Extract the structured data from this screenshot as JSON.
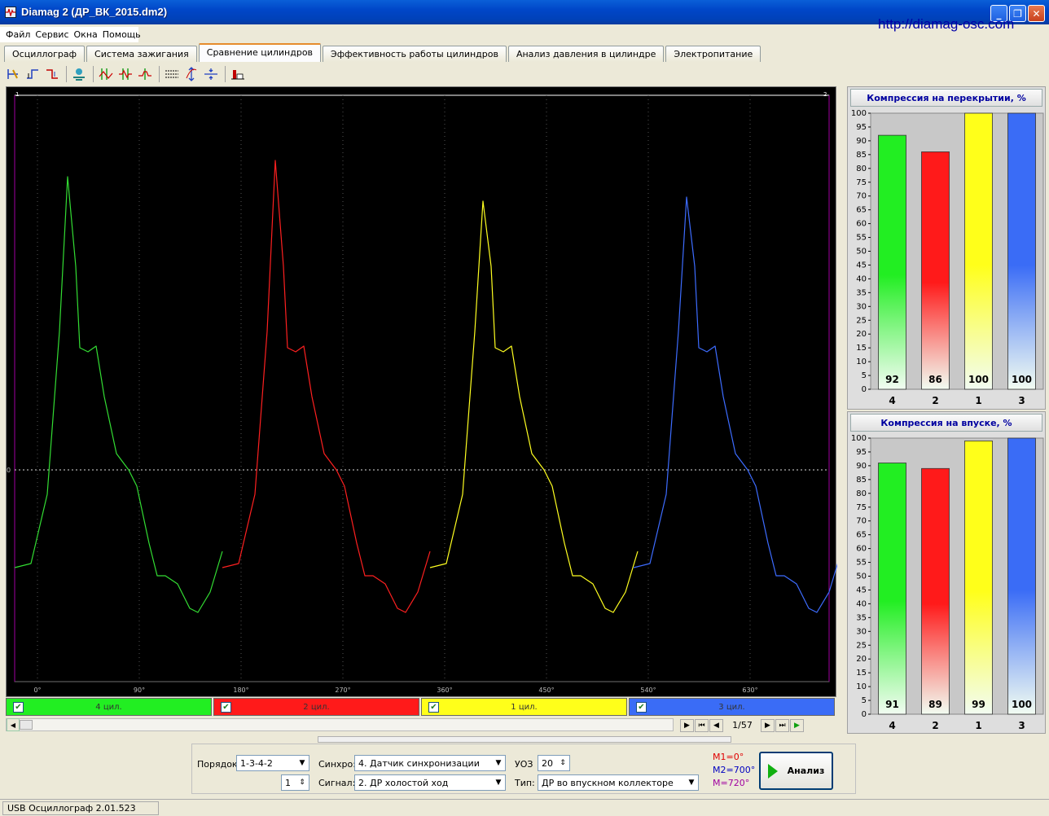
{
  "window": {
    "title": "Diamag 2 (ДР_ВК_2015.dm2)",
    "website": "http://diamag-osc.com"
  },
  "menu": [
    "Файл",
    "Сервис",
    "Окна",
    "Помощь"
  ],
  "tabs": [
    {
      "label": "Осциллограф",
      "active": false
    },
    {
      "label": "Система зажигания",
      "active": false
    },
    {
      "label": "Сравнение цилиндров",
      "active": true
    },
    {
      "label": "Эффективность работы цилиндров",
      "active": false
    },
    {
      "label": "Анализ давления в цилиндре",
      "active": false
    },
    {
      "label": "Электропитание",
      "active": false
    }
  ],
  "toolbar_icons": [
    "cursor-tool-icon",
    "rising-edge-icon",
    "falling-edge-icon",
    "sync-icon",
    "marker-1-icon",
    "marker-2-icon",
    "marker-3-icon",
    "grid-lines-icon",
    "scale-vertical-icon",
    "level-line-icon",
    "bars-chart-icon"
  ],
  "scope": {
    "corner_left": "1",
    "corner_right": "2",
    "zero_label": "0",
    "x_ticks": [
      "0°",
      "90°",
      "180°",
      "270°",
      "360°",
      "450°",
      "540°",
      "630°"
    ],
    "traces": [
      {
        "cylinder": "4",
        "color": "#33dd33"
      },
      {
        "cylinder": "2",
        "color": "#ff2020"
      },
      {
        "cylinder": "1",
        "color": "#ffff20"
      },
      {
        "cylinder": "3",
        "color": "#3d6cff"
      }
    ]
  },
  "cylinders": [
    {
      "label": "4 цил.",
      "color": "#22ee22",
      "checked": true
    },
    {
      "label": "2 цил.",
      "color": "#ff1a1a",
      "checked": true
    },
    {
      "label": "1 цил.",
      "color": "#ffff1a",
      "checked": true
    },
    {
      "label": "3 цил.",
      "color": "#3a6cf6",
      "checked": true
    }
  ],
  "navigation": {
    "page": "1/57"
  },
  "chart_data": [
    {
      "type": "bar",
      "title": "Компрессия на перекрытии, %",
      "categories": [
        "4",
        "2",
        "1",
        "3"
      ],
      "values": [
        92,
        86,
        100,
        100
      ],
      "colors": [
        "#22ee22",
        "#ff1a1a",
        "#ffff1a",
        "#3a6cf6"
      ],
      "ylim": [
        0,
        100
      ],
      "yticks": [
        0,
        5,
        10,
        15,
        20,
        25,
        30,
        35,
        40,
        45,
        50,
        55,
        60,
        65,
        70,
        75,
        80,
        85,
        90,
        95,
        100
      ]
    },
    {
      "type": "bar",
      "title": "Компрессия на впуске, %",
      "categories": [
        "4",
        "2",
        "1",
        "3"
      ],
      "values": [
        91,
        89,
        99,
        100
      ],
      "colors": [
        "#22ee22",
        "#ff1a1a",
        "#ffff1a",
        "#3a6cf6"
      ],
      "ylim": [
        0,
        100
      ],
      "yticks": [
        0,
        5,
        10,
        15,
        20,
        25,
        30,
        35,
        40,
        45,
        50,
        55,
        60,
        65,
        70,
        75,
        80,
        85,
        90,
        95,
        100
      ]
    }
  ],
  "settings": {
    "order_label": "Порядок",
    "order_value": "1-3-4-2",
    "order_num": "1",
    "sync_label": "Синхро:",
    "sync_value": "4. Датчик синхронизации",
    "signal_label": "Сигнал:",
    "signal_value": "2. ДР холостой ход",
    "uoz_label": "УОЗ",
    "uoz_value": "20",
    "type_label": "Тип:",
    "type_value": "ДР во впускном коллекторе",
    "m1": "M1=0°",
    "m2": "M2=700°",
    "m3": "M=720°",
    "m1_color": "#e00000",
    "m2_color": "#0000c0",
    "m3_color": "#a000a0",
    "analyze_label": "Анализ"
  },
  "status": {
    "text": "USB Осциллограф  2.01.523"
  }
}
